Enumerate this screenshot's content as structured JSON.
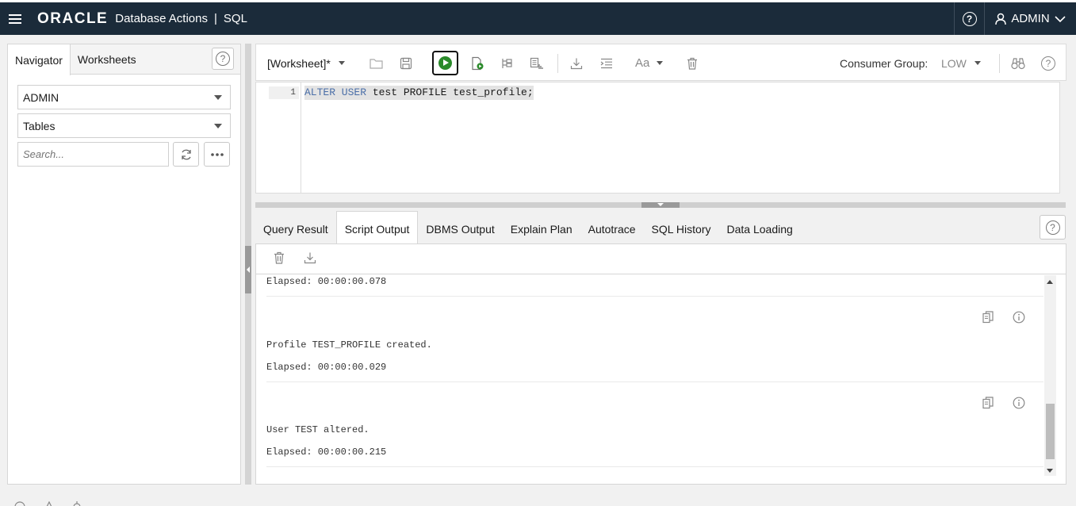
{
  "header": {
    "logo": "ORACLE",
    "app_title": "Database Actions",
    "separator": "|",
    "page": "SQL",
    "help_icon": "help-circle-icon",
    "user": "ADMIN"
  },
  "navigator": {
    "tabs": [
      "Navigator",
      "Worksheets"
    ],
    "active_tab": "Navigator",
    "schema_select": "ADMIN",
    "object_type_select": "Tables",
    "search_placeholder": "Search..."
  },
  "worksheet": {
    "name": "[Worksheet]*",
    "consumer_group_label": "Consumer Group:",
    "consumer_group_value": "LOW",
    "font_menu_label": "Aa",
    "lines": [
      {
        "number": "1",
        "keyword": "ALTER USER",
        "rest": " test PROFILE test_profile;"
      }
    ]
  },
  "output": {
    "tabs": [
      "Query Result",
      "Script Output",
      "DBMS Output",
      "Explain Plan",
      "Autotrace",
      "SQL History",
      "Data Loading"
    ],
    "active_tab": "Script Output",
    "entries": [
      {
        "message": "",
        "elapsed": "Elapsed: 00:00:00.078"
      },
      {
        "message": "Profile TEST_PROFILE created.",
        "elapsed": "Elapsed: 00:00:00.029"
      },
      {
        "message": "User TEST altered.",
        "elapsed": "Elapsed: 00:00:00.215"
      }
    ]
  },
  "colors": {
    "header_bg": "#1b2b3a",
    "run_green": "#2a8a2a",
    "keyword_blue": "#4b6fa8"
  }
}
